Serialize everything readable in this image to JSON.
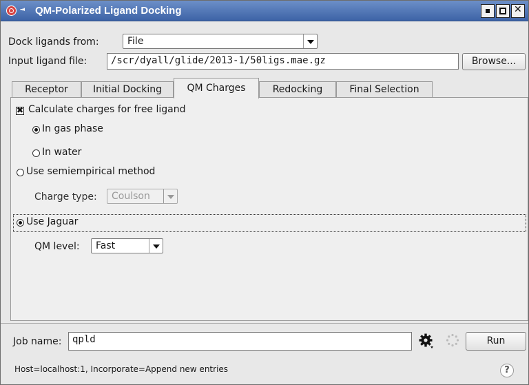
{
  "window": {
    "title": "QM-Polarized Ligand Docking"
  },
  "source": {
    "label": "Dock ligands from:",
    "selected": "File",
    "file_label": "Input ligand file:",
    "file_value": "/scr/dyall/glide/2013-1/50ligs.mae.gz",
    "browse_label": "Browse..."
  },
  "tabs": [
    {
      "label": "Receptor",
      "active": false
    },
    {
      "label": "Initial Docking",
      "active": false
    },
    {
      "label": "QM Charges",
      "active": true
    },
    {
      "label": "Redocking",
      "active": false
    },
    {
      "label": "Final Selection",
      "active": false
    }
  ],
  "qm_charges": {
    "calc_free_ligand": {
      "label": "Calculate charges for free ligand",
      "checked": true
    },
    "gas_phase": {
      "label": "In gas phase",
      "checked": true
    },
    "water": {
      "label": "In water",
      "checked": false
    },
    "semiempirical": {
      "label": "Use semiempirical method",
      "checked": false
    },
    "charge_type": {
      "label": "Charge type:",
      "selected": "Coulson"
    },
    "jaguar": {
      "label": "Use Jaguar",
      "checked": true
    },
    "qm_level": {
      "label": "QM level:",
      "selected": "Fast"
    }
  },
  "footer": {
    "job_name_label": "Job name:",
    "job_name_value": "qpld",
    "run_label": "Run",
    "status_text": "Host=localhost:1, Incorporate=Append new entries",
    "help_glyph": "?"
  },
  "icons": {
    "settings": "gear-icon",
    "progress": "spinner-icon",
    "help": "help-icon"
  }
}
